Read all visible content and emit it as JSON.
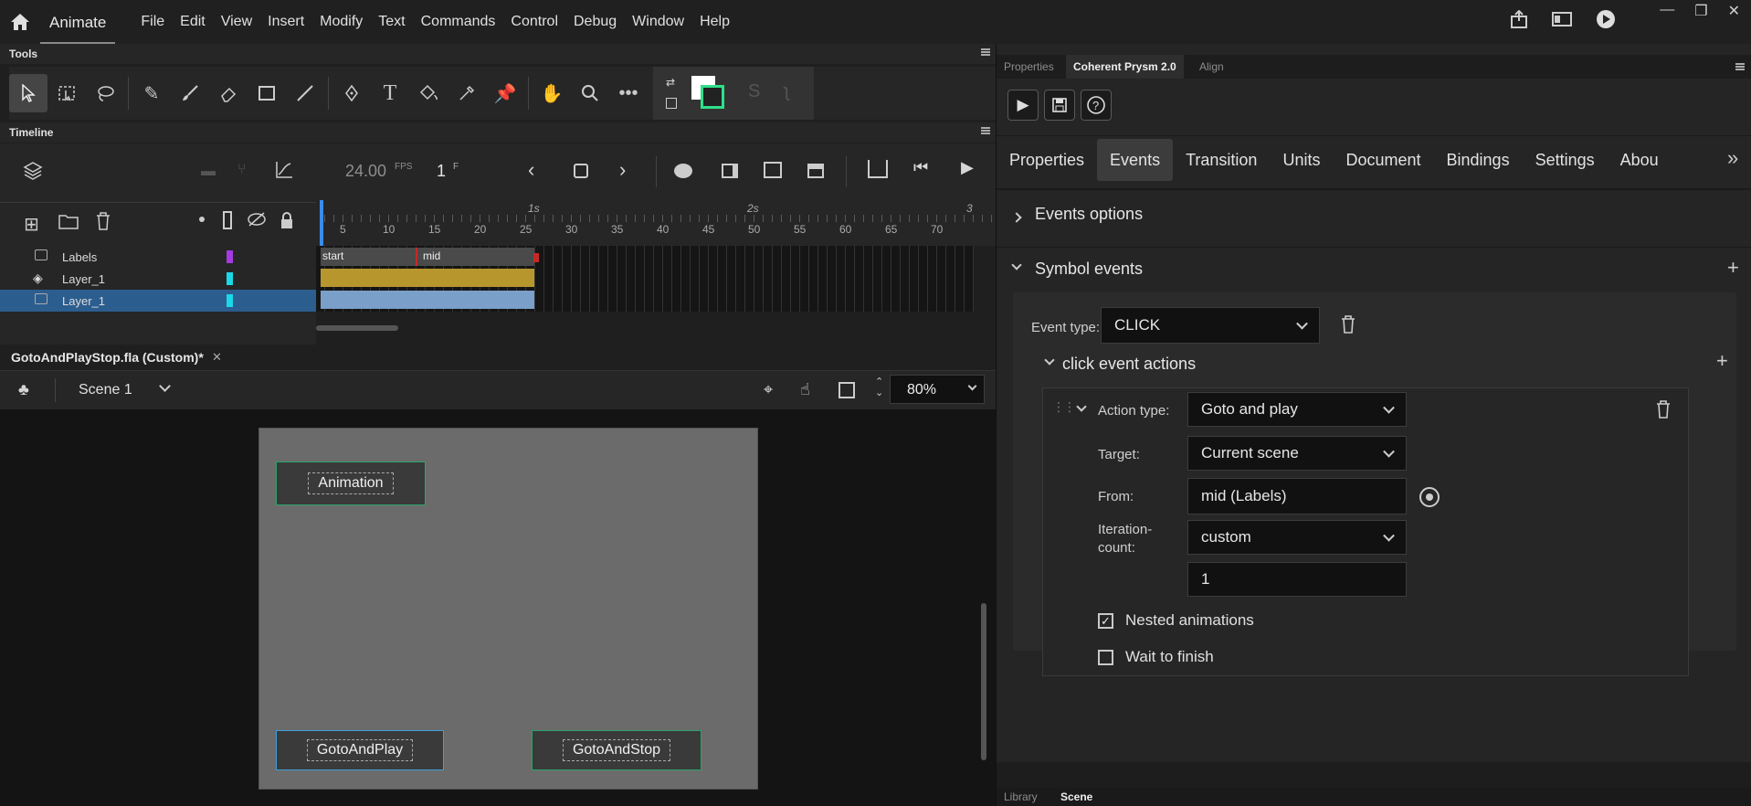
{
  "menubar": {
    "app_name": "Animate",
    "items": [
      "File",
      "Edit",
      "View",
      "Insert",
      "Modify",
      "Text",
      "Commands",
      "Control",
      "Debug",
      "Window",
      "Help"
    ]
  },
  "tools": {
    "title": "Tools"
  },
  "timeline": {
    "title": "Timeline",
    "fps": "24.00",
    "fps_unit": "FPS",
    "frame": "1",
    "frame_unit": "F",
    "ruler": [
      "5",
      "10",
      "15",
      "20",
      "25",
      "30",
      "35",
      "40",
      "45",
      "50",
      "55",
      "60",
      "65",
      "70"
    ],
    "ruler_seconds": [
      "1s",
      "2s",
      "3"
    ],
    "layers": [
      {
        "name": "Labels",
        "color": "#a43be0"
      },
      {
        "name": "Layer_1",
        "color": "#1ad8e8"
      },
      {
        "name": "Layer_1",
        "color": "#1ad8e8"
      }
    ],
    "labels": {
      "start": "start",
      "mid": "mid"
    }
  },
  "document": {
    "tab": "GotoAndPlayStop.fla (Custom)*",
    "scene": "Scene 1",
    "zoom": "80%"
  },
  "stage": {
    "buttons": {
      "animation": "Animation",
      "play": "GotoAndPlay",
      "stop": "GotoAndStop"
    }
  },
  "right_panel": {
    "top_tabs": [
      "Properties",
      "Coherent Prysm 2.0",
      "Align"
    ],
    "tabs": [
      "Properties",
      "Events",
      "Transition",
      "Units",
      "Document",
      "Bindings",
      "Settings",
      "Abou"
    ],
    "events_options": "Events options",
    "symbol_events": "Symbol events",
    "event_type_label": "Event type:",
    "event_type": "CLICK",
    "click_actions": "click event actions",
    "action_type_label": "Action type:",
    "action_type": "Goto and play",
    "target_label": "Target:",
    "target": "Current scene",
    "from_label": "From:",
    "from": "mid (Labels)",
    "iteration_label_1": "Iteration-",
    "iteration_label_2": "count:",
    "iteration": "custom",
    "iteration_value": "1",
    "nested_label": "Nested animations",
    "nested_checked": true,
    "wait_label": "Wait to finish",
    "wait_checked": false,
    "bottom_tabs": [
      "Library",
      "Scene"
    ]
  }
}
